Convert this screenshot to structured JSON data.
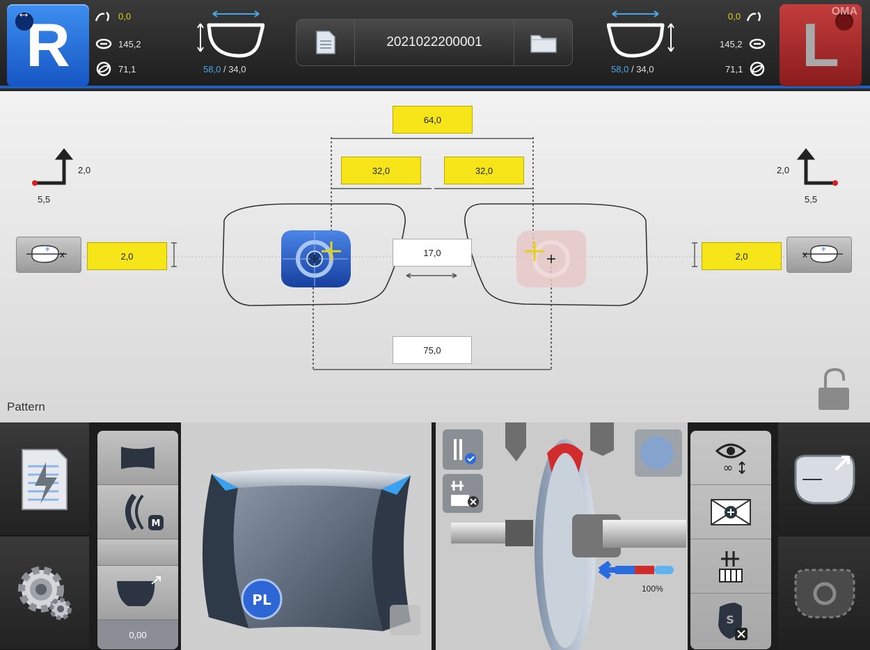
{
  "right_side": {
    "label": "R"
  },
  "left_side": {
    "label": "L",
    "badge": "OMA"
  },
  "right_measures": {
    "bevel": "0,0",
    "wrap": "145,2",
    "tilt": "71,1"
  },
  "left_measures": {
    "bevel": "0,0",
    "wrap": "145,2",
    "tilt": "71,1"
  },
  "right_frame": {
    "width": "58,0",
    "sep": "/",
    "height": "34,0"
  },
  "left_frame": {
    "width": "58,0",
    "sep": "/",
    "height": "34,0"
  },
  "job": {
    "number": "2021022200001"
  },
  "layout": {
    "pd_total": "64,0",
    "pd_right": "32,0",
    "pd_left": "32,0",
    "bridge": "17,0",
    "frame_pd": "75,0",
    "height_right": "2,0",
    "height_left": "2,0",
    "offset_right_y": "2,0",
    "offset_right_x": "5,5",
    "offset_left_y": "2,0",
    "offset_left_x": "5,5",
    "panel_label": "Pattern"
  },
  "bottom": {
    "material_badge": "PL",
    "m_badge": "M",
    "option_value": "0,00",
    "pressure_percent": "100%"
  },
  "colors": {
    "accent": "#1d5fc2",
    "highlight": "#f6e619",
    "right": "#2a6fe0",
    "left": "#c33d3d"
  }
}
